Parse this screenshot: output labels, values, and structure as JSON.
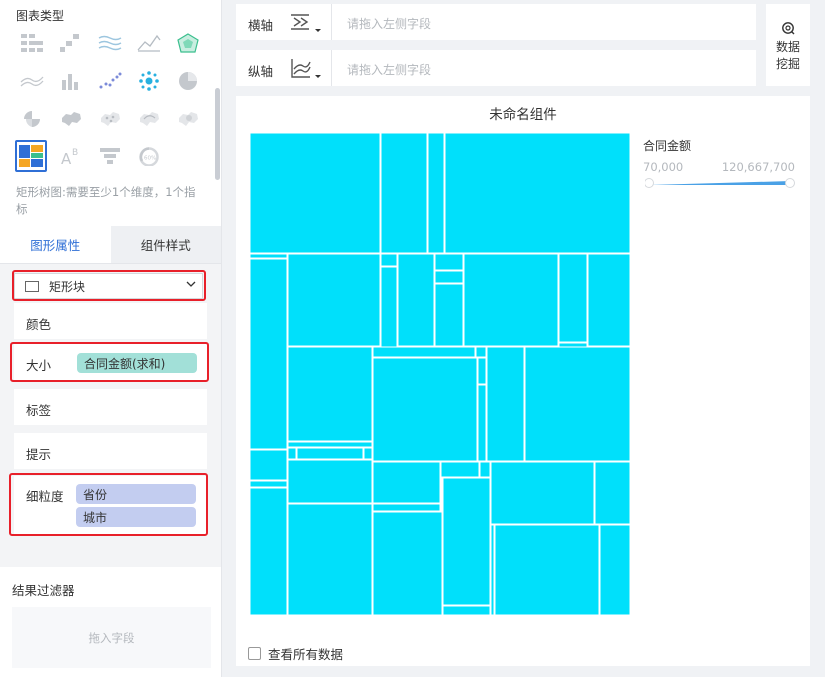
{
  "chart_types": {
    "title": "图表类型",
    "icons": [
      "grouped-table-icon",
      "crosstab-icon",
      "multi-line-icon",
      "area-line-icon",
      "radar-icon",
      "stacked-area-icon",
      "bar-chart-icon",
      "scatter-icon",
      "bubble-cluster-icon",
      "pie-chart-icon",
      "rose-chart-icon",
      "china-map-icon",
      "point-map-icon",
      "flow-map-icon",
      "heat-map-icon",
      "treemap-icon",
      "word-cloud-icon",
      "funnel-icon",
      "gauge-icon"
    ],
    "selected": "treemap-icon",
    "hint": "矩形树图:需要至少1个维度，1个指标"
  },
  "tabs": {
    "graphic_props": "图形属性",
    "component_style": "组件样式"
  },
  "props": {
    "shape": "矩形块",
    "color_label": "颜色",
    "size_label": "大小",
    "size_field": "合同金额(求和)",
    "label_label": "标签",
    "tooltip_label": "提示",
    "granularity_label": "细粒度",
    "granularity_fields": [
      "省份",
      "城市"
    ]
  },
  "filter": {
    "title": "结果过滤器",
    "placeholder": "拖入字段"
  },
  "axes": {
    "x_label": "横轴",
    "y_label": "纵轴",
    "placeholder": "请拖入左侧字段"
  },
  "mining": {
    "label": "数据挖掘"
  },
  "widget": {
    "title": "未命名组件",
    "legend_title": "合同金额",
    "legend_min": "70,000",
    "legend_max": "120,667,700",
    "show_all_label": "查看所有数据"
  },
  "colors": {
    "accent": "#2f6fd6",
    "treemap_fill": "#00e0fb",
    "highlight": "#e8202a",
    "legend_bar": "#4aa1e6"
  }
}
